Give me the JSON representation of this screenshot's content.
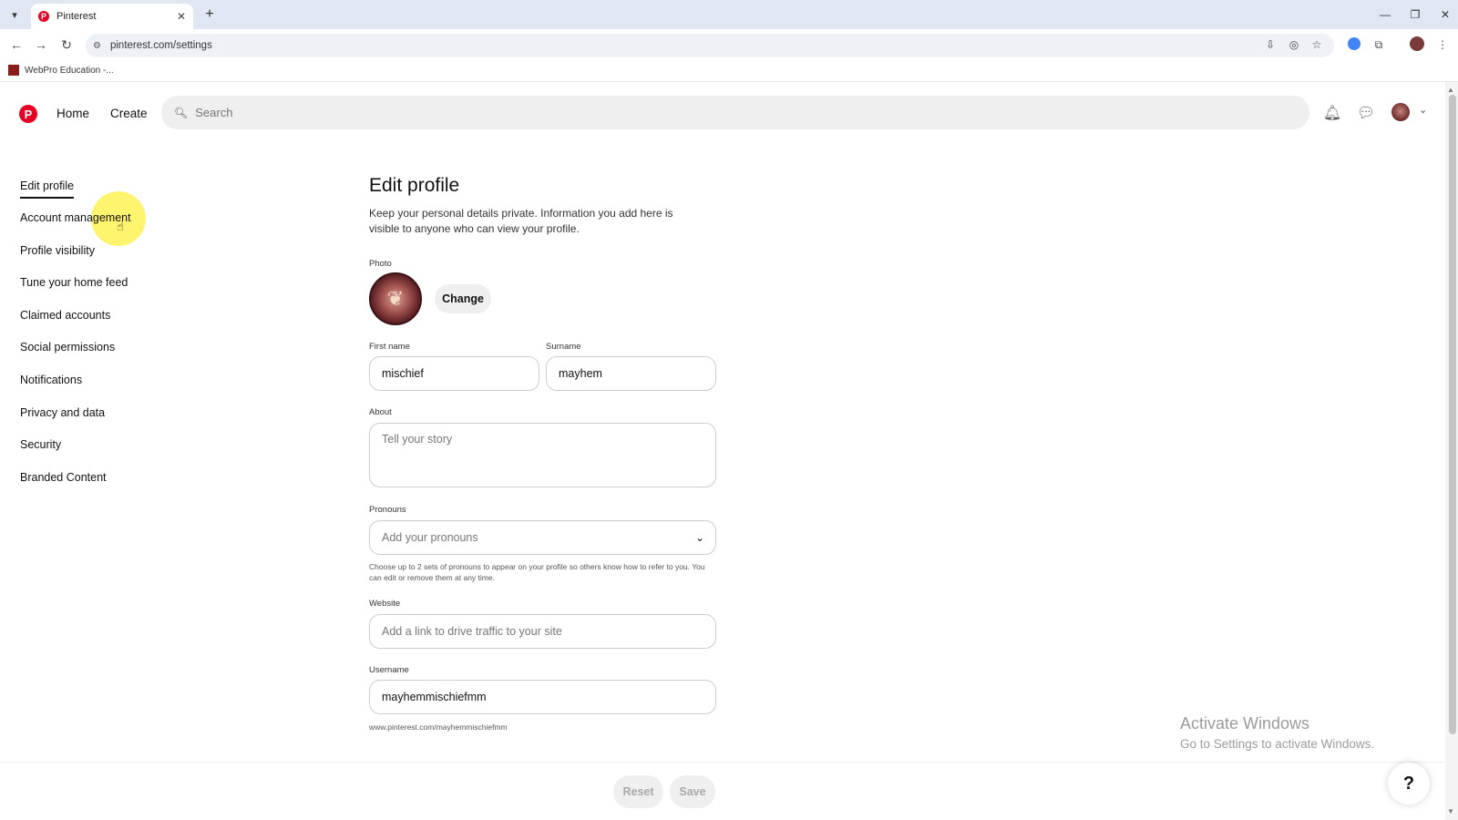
{
  "browser": {
    "tab_title": "Pinterest",
    "tab_favicon": "P",
    "tab_close": "✕",
    "new_tab": "+",
    "url": "pinterest.com/settings",
    "bookmark": "WebPro Education -..."
  },
  "header": {
    "logo": "P",
    "nav": {
      "home": "Home",
      "create": "Create"
    },
    "search_placeholder": "Search"
  },
  "sidebar": {
    "items": [
      {
        "label": "Edit profile"
      },
      {
        "label": "Account management"
      },
      {
        "label": "Profile visibility"
      },
      {
        "label": "Tune your home feed"
      },
      {
        "label": "Claimed accounts"
      },
      {
        "label": "Social permissions"
      },
      {
        "label": "Notifications"
      },
      {
        "label": "Privacy and data"
      },
      {
        "label": "Security"
      },
      {
        "label": "Branded Content"
      }
    ]
  },
  "form": {
    "title": "Edit profile",
    "description": "Keep your personal details private. Information you add here is visible to anyone who can view your profile.",
    "photo_label": "Photo",
    "change_button": "Change",
    "first_name_label": "First name",
    "first_name_value": "mischief",
    "surname_label": "Surname",
    "surname_value": "mayhem",
    "about_label": "About",
    "about_placeholder": "Tell your story",
    "pronouns_label": "Pronouns",
    "pronouns_placeholder": "Add your pronouns",
    "pronouns_hint": "Choose up to 2 sets of pronouns to appear on your profile so others know how to refer to you. You can edit or remove them at any time.",
    "website_label": "Website",
    "website_placeholder": "Add a link to drive traffic to your site",
    "username_label": "Username",
    "username_value": "mayhemmischiefmm",
    "profile_url": "www.pinterest.com/mayhemmischiefmm"
  },
  "actions": {
    "reset": "Reset",
    "save": "Save",
    "help": "?"
  },
  "watermark": {
    "line1": "Activate Windows",
    "line2": "Go to Settings to activate Windows."
  },
  "colors": {
    "brand": "#e60023",
    "tabbar": "#dfe7f3",
    "input_border": "#cdcdcd",
    "button_bg": "#efefef",
    "cursor_highlight": "#fff03c"
  },
  "icons": {
    "back": "back-arrow-icon",
    "forward": "forward-arrow-icon",
    "reload": "reload-icon",
    "search": "search-icon",
    "notifications": "bell-icon",
    "messages": "chat-bubble-icon",
    "pronouns_dropdown": "chevron-down-icon"
  }
}
